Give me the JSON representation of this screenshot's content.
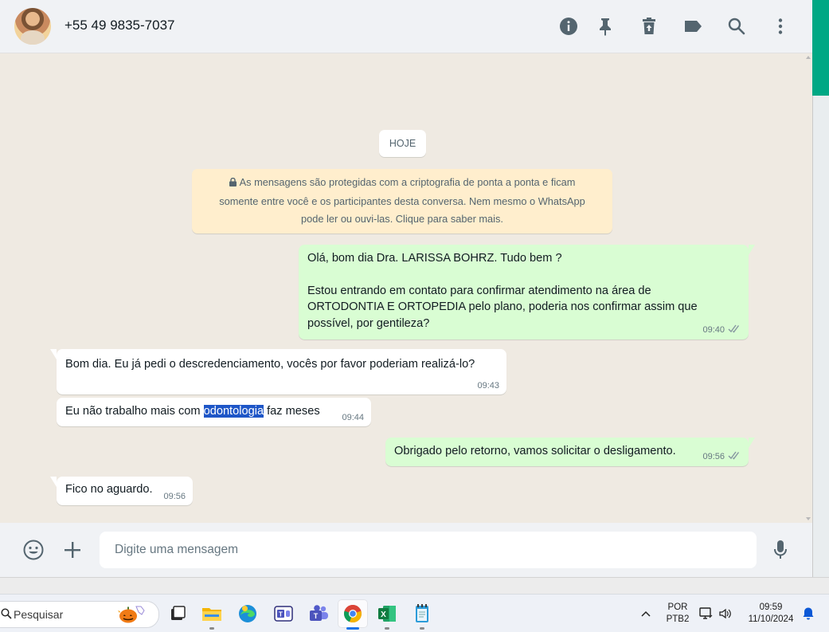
{
  "header": {
    "contact_name": "+55 49 9835-7037"
  },
  "chat": {
    "date_label": "HOJE",
    "encryption_notice": [
      "As mensagens são protegidas com a criptografia de ponta a ponta e ficam",
      "somente entre você e os participantes desta conversa. Nem mesmo o WhatsApp",
      "pode ler ou ouvi-las. Clique para saber mais."
    ],
    "messages": [
      {
        "direction": "outgoing",
        "lines": [
          "Olá, bom dia Dra. LARISSA BOHRZ. Tudo bem ?",
          "",
          "Estou entrando em contato para confirmar atendimento na área de",
          "ORTODONTIA E ORTOPEDIA pelo plano, poderia nos confirmar assim que",
          "possível, por gentileza?"
        ],
        "time": "09:40",
        "status": "read"
      },
      {
        "direction": "incoming",
        "lines": [
          "Bom dia. Eu já pedi o descredenciamento, vocês por favor poderiam realizá-lo?"
        ],
        "time": "09:43"
      },
      {
        "direction": "incoming",
        "text_before": "Eu não trabalho mais com ",
        "text_highlight": "odontologia",
        "text_after": " faz meses",
        "time": "09:44"
      },
      {
        "direction": "outgoing",
        "lines": [
          "Obrigado pelo retorno, vamos solicitar o desligamento."
        ],
        "time": "09:56",
        "status": "read"
      },
      {
        "direction": "incoming",
        "lines": [
          "Fico no aguardo."
        ],
        "time": "09:56"
      }
    ]
  },
  "composer": {
    "placeholder": "Digite uma mensagem"
  },
  "taskbar": {
    "search_placeholder": "Pesquisar",
    "language_top": "POR",
    "language_bottom": "PTB2",
    "time": "09:59",
    "date": "11/10/2024"
  },
  "colors": {
    "outgoing_bubble": "#d9fdd3",
    "incoming_bubble": "#ffffff",
    "chat_background": "#efeae2",
    "encryption_notice_bg": "#ffeecd",
    "read_ticks": "#8696a0",
    "selection_highlight": "#1e56c7",
    "accent_green": "#00a884"
  }
}
